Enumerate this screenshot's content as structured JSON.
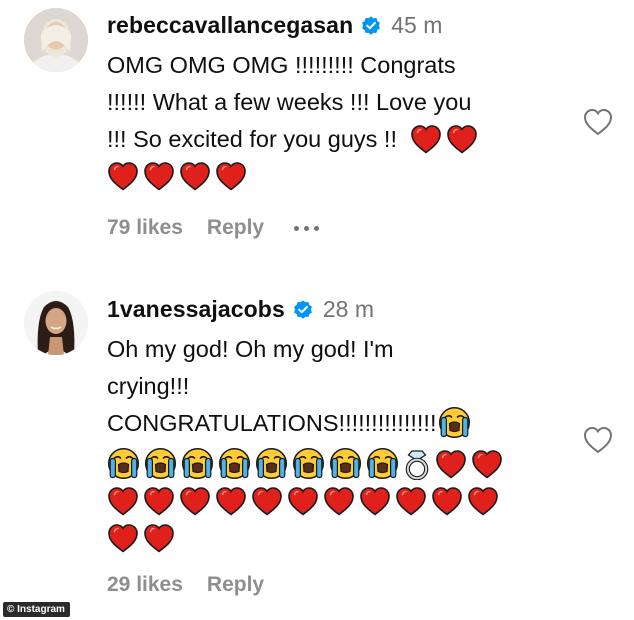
{
  "comments": [
    {
      "username": "rebeccavallancegasan",
      "time": "45 m",
      "lines": [
        "OMG OMG OMG !!!!!!!!! Congrats",
        "!!!!!! What a few weeks !!! Love you",
        "!!! So excited for you guys !!"
      ],
      "likes": "79 likes",
      "reply": "Reply"
    },
    {
      "username": "1vanessajacobs",
      "time": "28 m",
      "lines": [
        "Oh my god! Oh my god! I'm",
        "crying!!!",
        "CONGRATULATIONS!!!!!!!!!!!!!!!"
      ],
      "likes": "29 likes",
      "reply": "Reply"
    }
  ],
  "icons": {
    "verified": "verified-badge-icon",
    "like": "heart-outline-icon",
    "more": "ellipsis-icon",
    "heart_emoji": "red-heart-emoji",
    "cry_emoji": "loudly-crying-face-emoji",
    "ring_emoji": "ring-emoji"
  },
  "colors": {
    "verified_blue": "#0095f6",
    "heart_red": "#e0201a",
    "secondary_text": "#737373"
  },
  "credit": "© Instagram"
}
